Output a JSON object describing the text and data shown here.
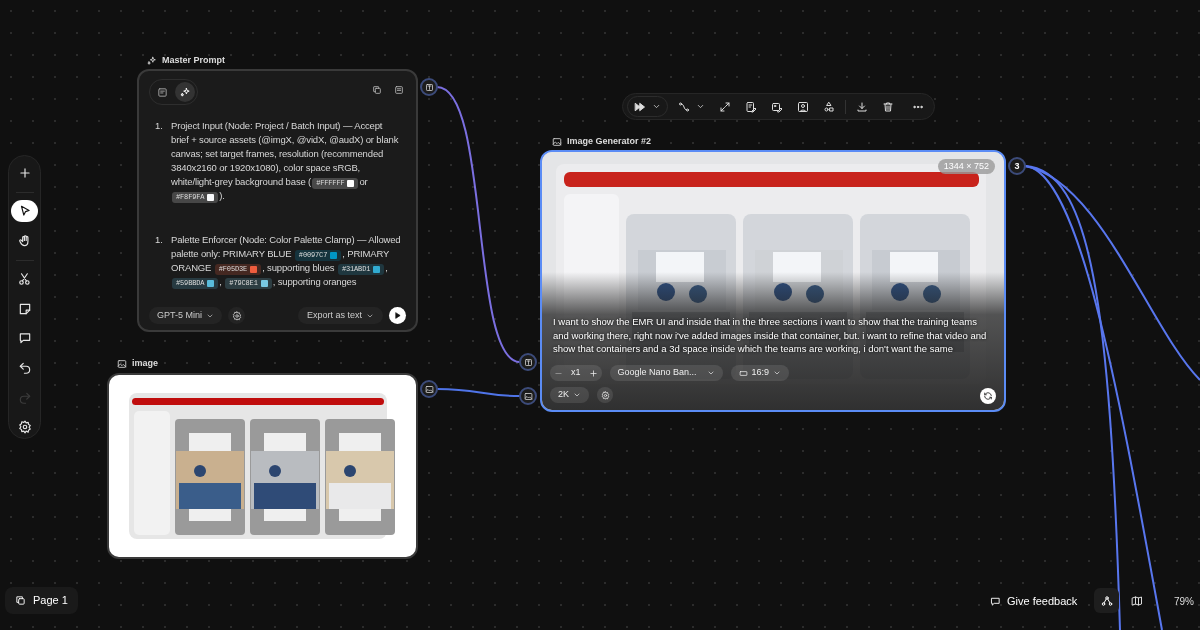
{
  "tool_palette": {
    "tools": [
      {
        "selected": false,
        "disabled": false
      },
      {
        "selected": true,
        "disabled": false
      },
      {
        "selected": false,
        "disabled": false
      },
      {
        "selected": false,
        "disabled": false
      },
      {
        "selected": false,
        "disabled": false
      },
      {
        "selected": false,
        "disabled": false
      },
      {
        "selected": false,
        "disabled": false
      },
      {
        "selected": false,
        "disabled": true
      },
      {
        "selected": false,
        "disabled": false
      }
    ]
  },
  "master_prompt": {
    "title": "Master Prompt",
    "mode_tabs": [
      {
        "selected": false
      },
      {
        "selected": true
      }
    ],
    "items": [
      {
        "number": "1.",
        "segments": [
          {
            "kind": "text",
            "text": "Project Input (Node: Project / Batch Input) — Accept brief + source assets (@imgX, @vidX, @audX) or blank canvas; set target frames, resolution (recommended 3840x2160 or 1920x1080), color space sRGB, white/light-grey background base ("
          },
          {
            "kind": "code",
            "text": "#FFFFFF",
            "color": "#ffffff"
          },
          {
            "kind": "text",
            "text": "or "
          },
          {
            "kind": "code",
            "text": "#F8F9FA",
            "color": "#f8f9fa"
          },
          {
            "kind": "text",
            "text": ")."
          }
        ]
      },
      {
        "number": "1.",
        "segments": [
          {
            "kind": "text",
            "text": "Palette Enforcer (Node: Color Palette Clamp) — Allowed palette only: PRIMARY BLUE "
          },
          {
            "kind": "code",
            "text": "#0097C7",
            "color": "#0097c7"
          },
          {
            "kind": "text",
            "text": ", PRIMARY ORANGE "
          },
          {
            "kind": "code",
            "text": "#F05D3E",
            "color": "#f05d3e"
          },
          {
            "kind": "text",
            "text": ", supporting blues "
          },
          {
            "kind": "code",
            "text": "#31ABD1",
            "color": "#31abd1"
          },
          {
            "kind": "text",
            "text": ", "
          },
          {
            "kind": "code",
            "text": "#59BBDA",
            "color": "#59bbda"
          },
          {
            "kind": "text",
            "text": ", "
          },
          {
            "kind": "code",
            "text": "#79C8E1",
            "color": "#79c8e1"
          },
          {
            "kind": "text",
            "text": ", supporting oranges"
          }
        ]
      }
    ],
    "model": "GPT-5 Mini",
    "export": "Export as text"
  },
  "image_node": {
    "title": "image",
    "kind": "picture"
  },
  "image_generator": {
    "title": "Image Generator #2",
    "selected": true,
    "kind": "picture",
    "size_badge": "1344 × 752",
    "prompt": "I want to show the EMR UI and inside that in the three sections i want to show that the training teams and working there, right now i've added images inside that container, but. i want to refine that video and show that containers and a 3d space inside which the teams are working, i don't want the same",
    "count": "x1",
    "model": "Google Nano Ban...",
    "aspect": "16:9",
    "quality": "2K",
    "output_count": "3"
  },
  "footer": {
    "page": "Page 1",
    "feedback": "Give feedback",
    "zoom": "79%"
  }
}
